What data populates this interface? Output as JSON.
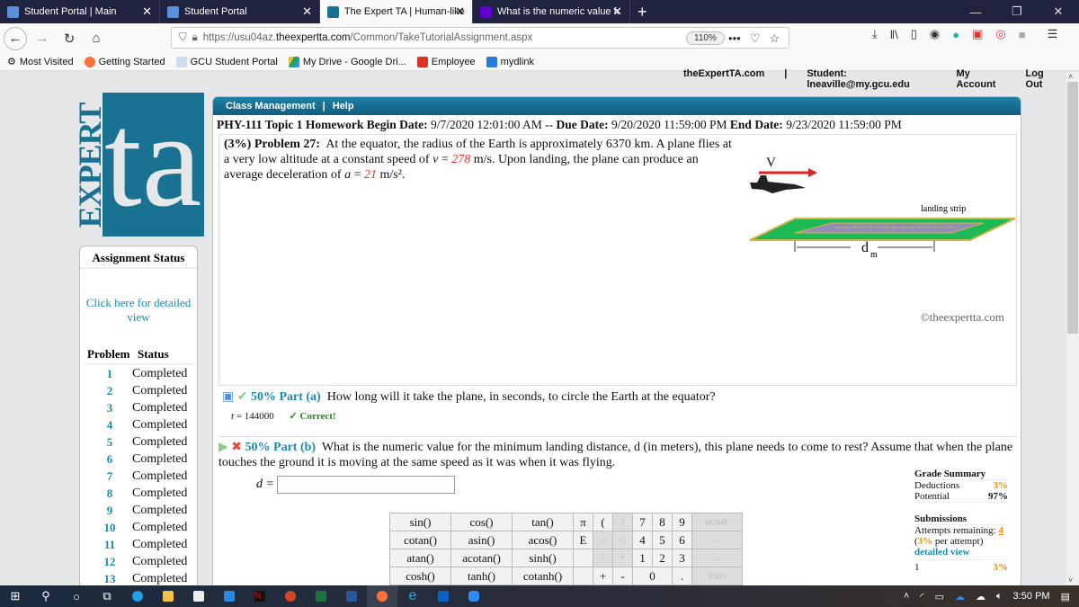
{
  "browser": {
    "tabs": [
      {
        "label": "Student Portal | Main",
        "icon_color": "#5b8fd8",
        "active": false
      },
      {
        "label": "Student Portal",
        "icon_color": "#5b8fd8",
        "active": false
      },
      {
        "label": "The Expert TA | Human-like Gra",
        "icon_color": "#1a7293",
        "active": true
      },
      {
        "label": "What is the numeric value for t",
        "icon_color": "#5f01d1",
        "active": false
      }
    ],
    "new_tab": "+",
    "window_controls": {
      "minimize": "—",
      "restore": "❐",
      "close": "✕"
    },
    "url": {
      "prefix": "https://usu04az.",
      "domain": "theexpertta.com",
      "path": "/Common/TakeTutorialAssignment.aspx"
    },
    "zoom": "110%",
    "bookmarks": [
      {
        "label": "Most Visited",
        "icon": "gear-icon",
        "color": "#555"
      },
      {
        "label": "Getting Started",
        "icon": "firefox-icon",
        "color": "#ff7139"
      },
      {
        "label": "GCU Student Portal",
        "icon": "portal-icon",
        "color": "#9ab"
      },
      {
        "label": "My Drive - Google Dri...",
        "icon": "drive-icon",
        "color": "#1fa463"
      },
      {
        "label": "Employee",
        "icon": "infor-icon",
        "color": "#d32"
      },
      {
        "label": "mydlink",
        "icon": "mydlink-icon",
        "color": "#2a7ae2"
      }
    ]
  },
  "site_nav": {
    "home": "theExpertTA.com",
    "separator": "|",
    "student": "Student: lneaville@my.gcu.edu",
    "account": "My Account",
    "logout": "Log Out"
  },
  "logo": {
    "expert": "EXPERT",
    "ta": "ta"
  },
  "sidebar": {
    "title": "Assignment Status",
    "detail_link": "Click here for detailed view",
    "col_problem": "Problem",
    "col_status": "Status",
    "problems": [
      {
        "num": "1",
        "status": "Completed"
      },
      {
        "num": "2",
        "status": "Completed"
      },
      {
        "num": "3",
        "status": "Completed"
      },
      {
        "num": "4",
        "status": "Completed"
      },
      {
        "num": "5",
        "status": "Completed"
      },
      {
        "num": "6",
        "status": "Completed"
      },
      {
        "num": "7",
        "status": "Completed"
      },
      {
        "num": "8",
        "status": "Completed"
      },
      {
        "num": "9",
        "status": "Completed"
      },
      {
        "num": "10",
        "status": "Completed"
      },
      {
        "num": "11",
        "status": "Completed"
      },
      {
        "num": "12",
        "status": "Completed"
      },
      {
        "num": "13",
        "status": "Completed"
      }
    ]
  },
  "menu": {
    "class_management": "Class Management",
    "sep": "|",
    "help": "Help"
  },
  "assignment": {
    "name": "PHY-111 Topic 1 Homework",
    "begin_label": "Begin Date:",
    "begin": "9/7/2020 12:01:00 AM",
    "sep": "--",
    "due_label": "Due Date:",
    "due": "9/20/2020 11:59:00 PM",
    "end_label": "End Date:",
    "end": "9/23/2020 11:59:00 PM"
  },
  "problem": {
    "weight": "(3%)",
    "label": "Problem 27:",
    "text1": "At the equator, the radius of the Earth is approximately 6370 km. A plane flies at a very low altitude at a constant speed of ",
    "v_sym": "v",
    "v_val": "278",
    "text2": " m/s. Upon landing, the plane can produce an average deceleration of ",
    "a_sym": "a",
    "a_val": "21",
    "text3": " m/s².",
    "figure": {
      "v_label": "V",
      "strip_label": "landing strip",
      "d_label": "d",
      "d_sub": "m"
    },
    "copyright": "©theexpertta.com"
  },
  "part_a": {
    "pct": "50%",
    "label": "Part (a)",
    "question": "How long will it take the plane, in seconds, to circle the Earth at the equator?",
    "answer_var": "t",
    "answer": "144000",
    "result": "✓ Correct!"
  },
  "part_b": {
    "pct": "50%",
    "label": "Part (b)",
    "question": "What is the numeric value for the minimum landing distance, d (in meters), this plane needs to come to rest? Assume that when the plane touches the ground it is moving at the same speed as it was when it was flying.",
    "input_var": "d",
    "input_value": ""
  },
  "keypad": {
    "rows": [
      [
        "sin()",
        "cos()",
        "tan()",
        "π",
        "(",
        ")",
        "7",
        "8",
        "9",
        "HOME"
      ],
      [
        "cotan()",
        "asin()",
        "acos()",
        "E",
        "↑^",
        "^↓",
        "4",
        "5",
        "6",
        "←"
      ],
      [
        "atan()",
        "acotan()",
        "sinh()",
        "",
        "/",
        "*",
        "1",
        "2",
        "3",
        "→"
      ],
      [
        "cosh()",
        "tanh()",
        "cotanh()",
        "",
        "+",
        "-",
        "0",
        "",
        ".",
        "END"
      ]
    ]
  },
  "grade_summary": {
    "title": "Grade Summary",
    "deductions_label": "Deductions",
    "deductions": "3%",
    "potential_label": "Potential",
    "potential": "97%",
    "submissions_title": "Submissions",
    "attempts_label": "Attempts remaining:",
    "attempts": "4",
    "per_attempt_pct": "3%",
    "per_attempt_text": "per attempt)",
    "detailed_view": "detailed view",
    "history": [
      {
        "num": "1",
        "pct": "3%"
      }
    ]
  },
  "taskbar": {
    "clock": "3:50 PM",
    "apps": [
      "windows-start-icon",
      "search-icon",
      "cortana-icon",
      "task-view-icon",
      "edge-icon",
      "file-explorer-icon",
      "store-icon",
      "mail-icon",
      "netflix-icon",
      "powerpoint-icon",
      "excel-icon",
      "word-icon",
      "firefox-icon",
      "ie-icon",
      "outlook-icon",
      "zoom-icon"
    ]
  }
}
